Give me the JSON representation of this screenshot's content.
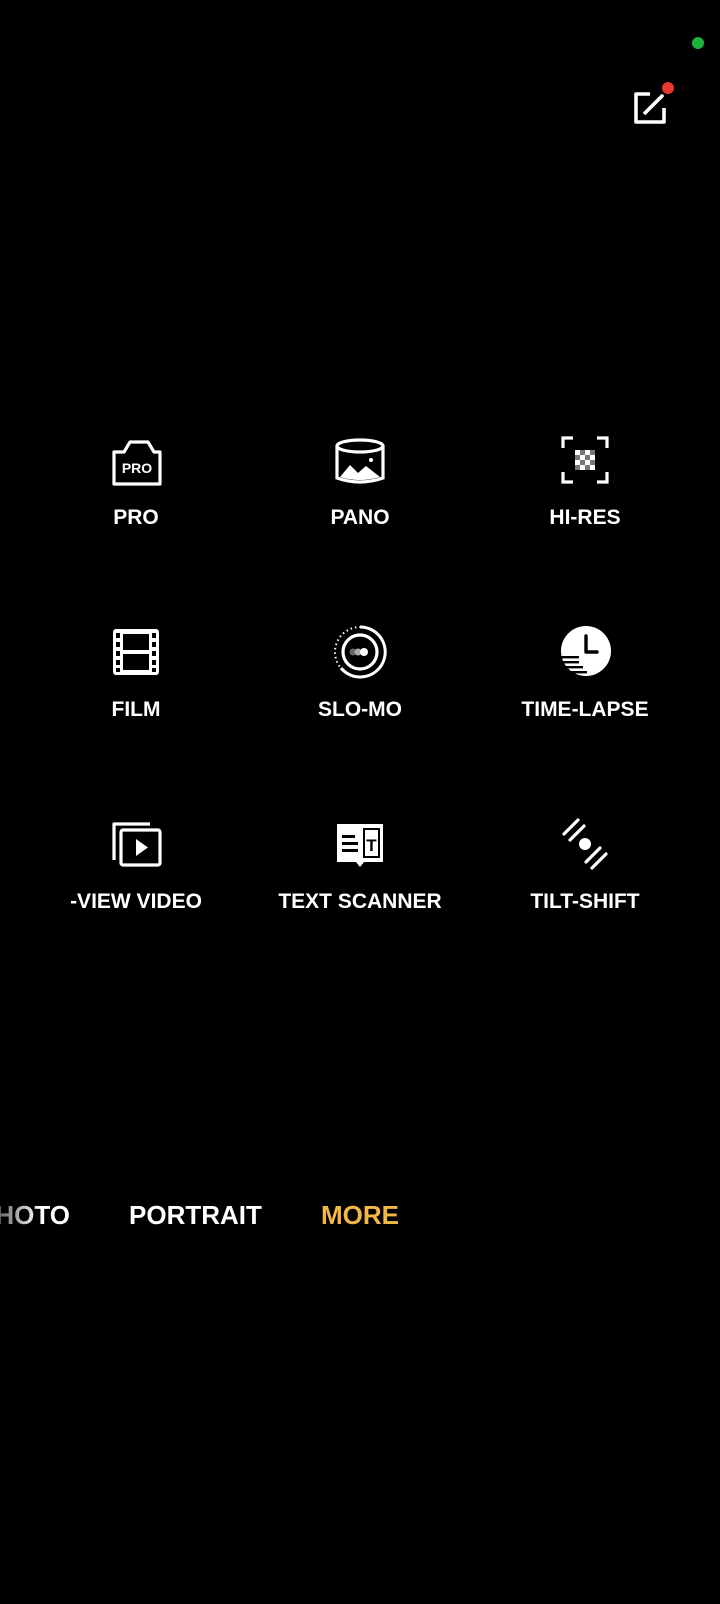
{
  "status": {
    "privacy_dot_color": "#1db33b"
  },
  "edit": {
    "icon": "edit-icon",
    "badge_color": "#e53935"
  },
  "modes": [
    {
      "label": "PRO",
      "icon": "pro-camera-icon",
      "icon_text": "PRO"
    },
    {
      "label": "PANO",
      "icon": "panorama-icon"
    },
    {
      "label": "HI-RES",
      "icon": "hi-res-icon"
    },
    {
      "label": "FILM",
      "icon": "film-icon"
    },
    {
      "label": "SLO-MO",
      "icon": "slow-motion-icon"
    },
    {
      "label": "TIME-LAPSE",
      "icon": "time-lapse-icon"
    },
    {
      "label": "-VIEW VIDEO",
      "icon": "dual-view-video-icon"
    },
    {
      "label": "TEXT SCANNER",
      "icon": "text-scanner-icon",
      "icon_text": "T"
    },
    {
      "label": "TILT-SHIFT",
      "icon": "tilt-shift-icon"
    }
  ],
  "mode_bar": {
    "tabs": [
      {
        "label": "HOTO"
      },
      {
        "label": "PORTRAIT"
      },
      {
        "label": "MORE"
      }
    ],
    "active_color": "#f3b844"
  }
}
